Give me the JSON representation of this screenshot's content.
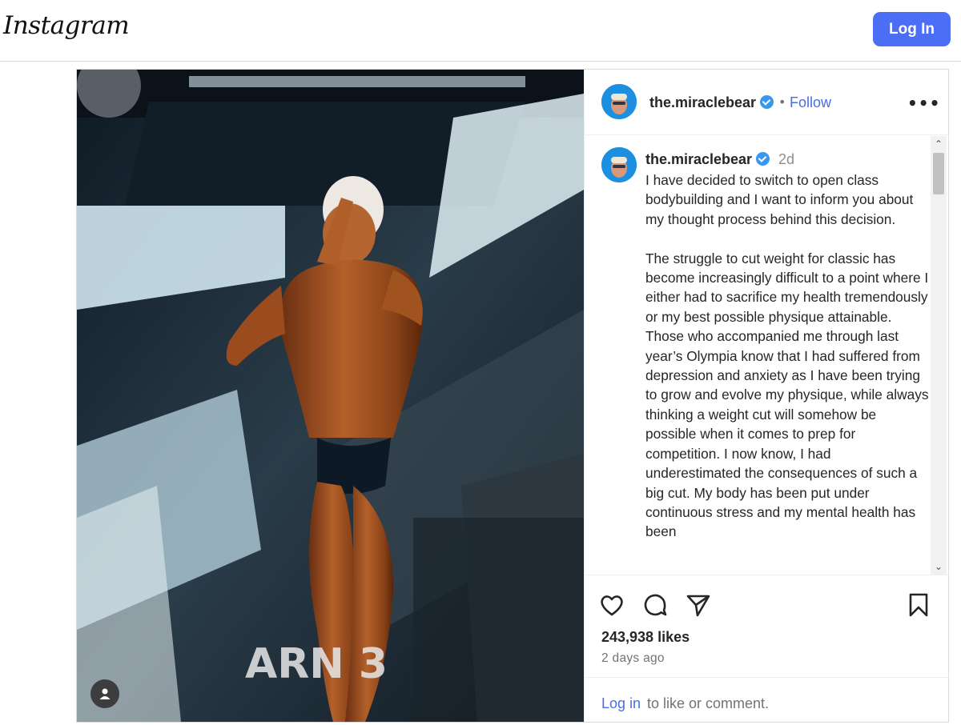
{
  "header": {
    "logo": "Instagram",
    "login_button": "Log In"
  },
  "post": {
    "username": "the.miraclebear",
    "separator": "•",
    "follow": "Follow",
    "more": "•••",
    "photo_alt": "Bodybuilder on stage",
    "stage_text": "ARN 3",
    "caption": {
      "username": "the.miraclebear",
      "time": "2d",
      "text": "I have decided to switch to open class bodybuilding and I want to inform you about my thought process behind this decision.\n\nThe struggle to cut weight for classic has become increasingly difficult to a point where I either had to sacrifice my health tremendously or my best possible physique attainable. Those who accompanied me through last year’s Olympia know that I had suffered from depression and anxiety as I have been trying to grow and evolve my physique, while always thinking a weight cut will somehow be possible when it comes to prep for competition. I now know, I had underestimated the consequences of such a big cut. My body has been put under continuous stress and my mental health has been"
    },
    "likes": "243,938 likes",
    "posted_ago": "2 days ago",
    "login_prompt": {
      "link": "Log in",
      "rest": "to like or comment."
    }
  },
  "colors": {
    "accent": "#4c6ef5",
    "link": "#4a6ee0",
    "verified": "#3897f0"
  },
  "icons": [
    "heart-icon",
    "comment-icon",
    "share-icon",
    "bookmark-icon",
    "verified-badge-icon",
    "user-tag-icon"
  ]
}
